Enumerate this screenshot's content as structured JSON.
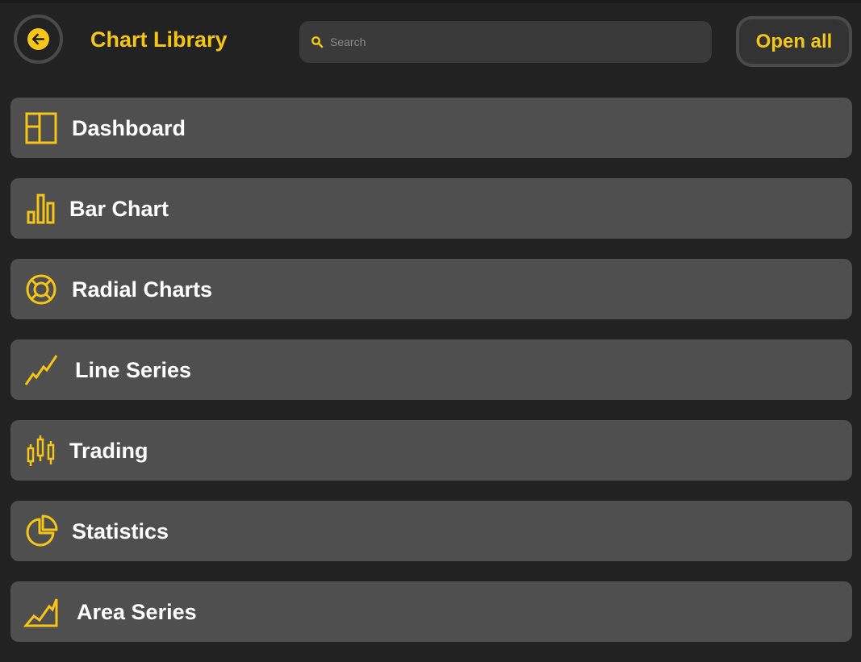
{
  "header": {
    "back_icon": "arrow-left-icon",
    "title": "Chart Library",
    "search": {
      "placeholder": "Search",
      "value": "",
      "icon": "search-icon"
    },
    "open_all_label": "Open all"
  },
  "colors": {
    "accent": "#f5c518",
    "background": "#222222",
    "row": "#4f4f4f",
    "input": "#3a3a3a"
  },
  "items": [
    {
      "label": "Dashboard",
      "icon": "dashboard-layout-icon"
    },
    {
      "label": "Bar Chart",
      "icon": "bar-chart-icon"
    },
    {
      "label": "Radial Charts",
      "icon": "radial-chart-icon"
    },
    {
      "label": "Line Series",
      "icon": "line-series-icon"
    },
    {
      "label": "Trading",
      "icon": "candlestick-icon"
    },
    {
      "label": "Statistics",
      "icon": "pie-chart-icon"
    },
    {
      "label": "Area Series",
      "icon": "area-chart-icon"
    }
  ]
}
